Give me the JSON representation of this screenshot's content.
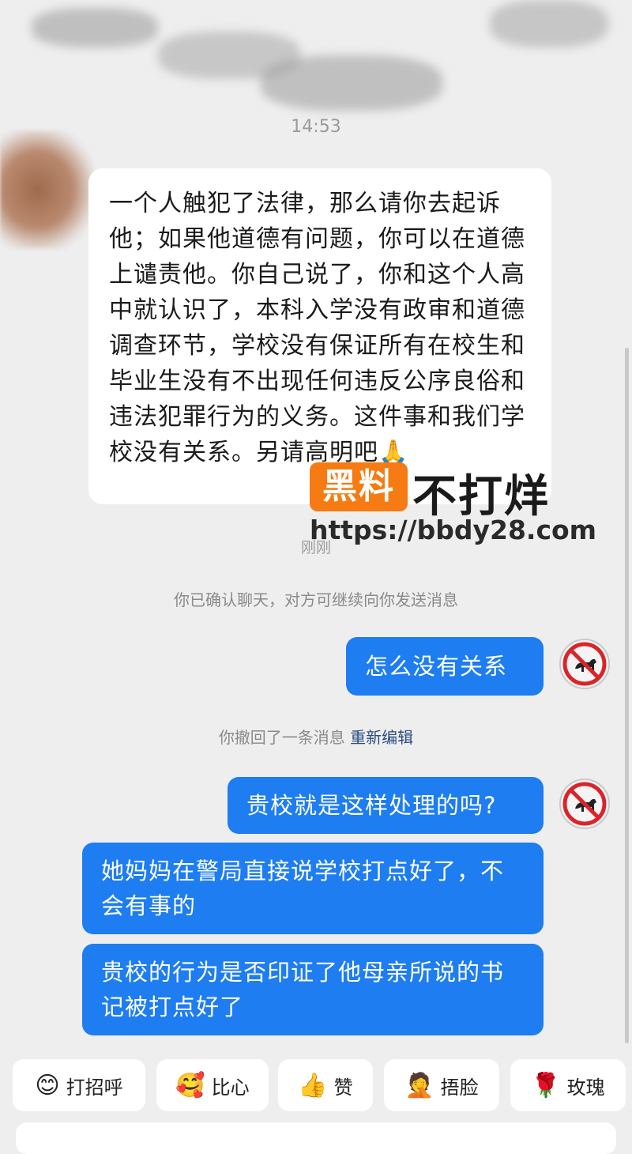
{
  "chat": {
    "timestamp": "14:53",
    "incoming": {
      "text": "一个人触犯了法律，那么请你去起诉他；如果他道德有问题，你可以在道德上谴责他。你自己说了，你和这个人高中就认识了，本科入学没有政审和道德调查环节，学校没有保证所有在校生和毕业生没有不出现任何违反公序良俗和违法犯罪行为的义务。这件事和我们学校没有关系。另请高明吧",
      "emoji": "🙏"
    },
    "just_now": "刚刚",
    "system_confirm": "你已确认聊天，对方可继续向你发送消息",
    "outgoing_1": "怎么没有关系",
    "recall_notice": "你撤回了一条消息",
    "recall_link": "重新编辑",
    "outgoing_2": "贵校就是这样处理的吗?",
    "outgoing_3": "她妈妈在警局直接说学校打点好了，不会有事的",
    "outgoing_4": "贵校的行为是否印证了他母亲所说的书记被打点好了"
  },
  "watermark": {
    "box_text": "黑料",
    "title": "不打烊",
    "url": "https://bbdy28.com"
  },
  "quick_replies": [
    {
      "icon": "😊",
      "label": "打招呼"
    },
    {
      "icon": "🥰",
      "label": "比心"
    },
    {
      "icon": "👍",
      "label": "赞"
    },
    {
      "icon": "🤦",
      "label": "捂脸"
    },
    {
      "icon": "🌹",
      "label": "玫瑰"
    }
  ],
  "colors": {
    "outgoing_bubble": "#1e7df0",
    "watermark_orange": "#f57b12",
    "background": "#eeeeef"
  }
}
